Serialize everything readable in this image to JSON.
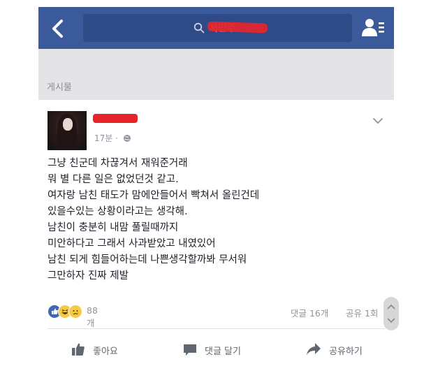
{
  "search": {
    "query_text": "서민주"
  },
  "section": {
    "label": "게시물"
  },
  "post": {
    "time": "17분 ·",
    "lines": [
      "그냥 친군데 차끊겨서 재워준거래",
      "뭐 별 다른 일은 없었던것 같고.",
      "여자랑 남친 태도가 맘에안들어서 빡쳐서 올린건데",
      "있을수있는 상황이라고는 생각해.",
      "남친이 충분히 내맘 풀릴때까지",
      "미안하다고 그래서 사과받았고 내였있어",
      "남친 되게 힘들어하는데 나쁜생각할까봐 무서워",
      "그만하자 진짜 제발"
    ],
    "reactions": {
      "icons": [
        "like",
        "haha",
        "sad"
      ],
      "count": "88개"
    },
    "comments_count": "댓글 16개",
    "shares_count": "공유 1회"
  },
  "actions": {
    "like": "좋아요",
    "comment": "댓글 달기",
    "share": "공유하기"
  },
  "icons": {
    "back": "chevron-left-icon",
    "search": "search-icon",
    "friends": "friend-requests-icon",
    "globe": "globe-icon",
    "menu": "chevron-down-icon",
    "like": "thumbs-up-icon",
    "comment": "comment-bubble-icon",
    "share": "share-arrow-icon"
  },
  "colors": {
    "navbar": "#3b5a9b",
    "search_box": "#2e4a87",
    "band": "#e4e4e7",
    "redaction": "#e8242b"
  }
}
